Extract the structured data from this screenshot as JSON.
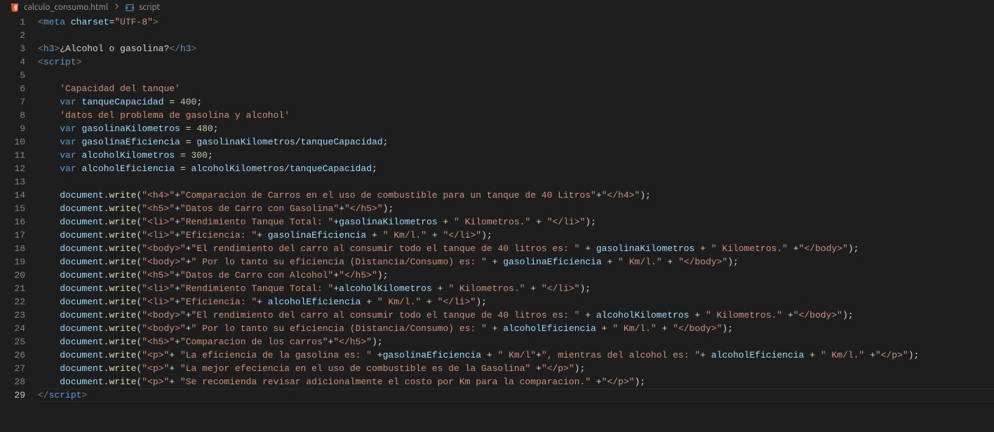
{
  "breadcrumb": {
    "file": "calculo_consumo.html",
    "symbol": "script"
  },
  "active_line": 29,
  "lines": [
    {
      "n": 1,
      "tokens": [
        [
          "punc",
          "<"
        ],
        [
          "tag",
          "meta"
        ],
        [
          "text",
          " "
        ],
        [
          "attr",
          "charset"
        ],
        [
          "op",
          "="
        ],
        [
          "str",
          "\"UTF-8\""
        ],
        [
          "punc",
          ">"
        ]
      ]
    },
    {
      "n": 2,
      "tokens": []
    },
    {
      "n": 3,
      "tokens": [
        [
          "punc",
          "<"
        ],
        [
          "tag",
          "h3"
        ],
        [
          "punc",
          ">"
        ],
        [
          "text",
          "¿Alcohol o gasolina?"
        ],
        [
          "punc",
          "</"
        ],
        [
          "tag",
          "h3"
        ],
        [
          "punc",
          ">"
        ]
      ]
    },
    {
      "n": 4,
      "tokens": [
        [
          "punc",
          "<"
        ],
        [
          "tag",
          "script"
        ],
        [
          "punc",
          ">"
        ]
      ]
    },
    {
      "n": 5,
      "tokens": []
    },
    {
      "n": 6,
      "indent": 4,
      "tokens": [
        [
          "str",
          "'Capacidad del tanque'"
        ]
      ]
    },
    {
      "n": 7,
      "indent": 4,
      "tokens": [
        [
          "kw",
          "var"
        ],
        [
          "text",
          " "
        ],
        [
          "var",
          "tanqueCapacidad"
        ],
        [
          "text",
          " "
        ],
        [
          "op",
          "="
        ],
        [
          "text",
          " "
        ],
        [
          "num",
          "400"
        ],
        [
          "text",
          ";"
        ]
      ]
    },
    {
      "n": 8,
      "indent": 4,
      "tokens": [
        [
          "str",
          "'datos del problema de gasolina y alcohol'"
        ]
      ]
    },
    {
      "n": 9,
      "indent": 4,
      "tokens": [
        [
          "kw",
          "var"
        ],
        [
          "text",
          " "
        ],
        [
          "var",
          "gasolinaKilometros"
        ],
        [
          "text",
          " "
        ],
        [
          "op",
          "="
        ],
        [
          "text",
          " "
        ],
        [
          "num",
          "480"
        ],
        [
          "text",
          ";"
        ]
      ]
    },
    {
      "n": 10,
      "indent": 4,
      "tokens": [
        [
          "kw",
          "var"
        ],
        [
          "text",
          " "
        ],
        [
          "var",
          "gasolinaEficiencia"
        ],
        [
          "text",
          " "
        ],
        [
          "op",
          "="
        ],
        [
          "text",
          " "
        ],
        [
          "var",
          "gasolinaKilometros"
        ],
        [
          "op",
          "/"
        ],
        [
          "var",
          "tanqueCapacidad"
        ],
        [
          "text",
          ";"
        ]
      ]
    },
    {
      "n": 11,
      "indent": 4,
      "tokens": [
        [
          "kw",
          "var"
        ],
        [
          "text",
          " "
        ],
        [
          "var",
          "alcoholKilometros"
        ],
        [
          "text",
          " "
        ],
        [
          "op",
          "="
        ],
        [
          "text",
          " "
        ],
        [
          "num",
          "300"
        ],
        [
          "text",
          ";"
        ]
      ]
    },
    {
      "n": 12,
      "indent": 4,
      "tokens": [
        [
          "kw",
          "var"
        ],
        [
          "text",
          " "
        ],
        [
          "var",
          "alcoholEficiencia"
        ],
        [
          "text",
          " "
        ],
        [
          "op",
          "="
        ],
        [
          "text",
          " "
        ],
        [
          "var",
          "alcoholKilometros"
        ],
        [
          "op",
          "/"
        ],
        [
          "var",
          "tanqueCapacidad"
        ],
        [
          "text",
          ";"
        ]
      ]
    },
    {
      "n": 13,
      "tokens": []
    },
    {
      "n": 14,
      "indent": 4,
      "tokens": [
        [
          "obj",
          "document"
        ],
        [
          "text",
          "."
        ],
        [
          "fn",
          "write"
        ],
        [
          "text",
          "("
        ],
        [
          "str",
          "\"<h4>\""
        ],
        [
          "op",
          "+"
        ],
        [
          "str",
          "\"Comparacion de Carros en el uso de combustible para un tanque de 40 Litros\""
        ],
        [
          "op",
          "+"
        ],
        [
          "str",
          "\"</h4>\""
        ],
        [
          "text",
          ");"
        ]
      ]
    },
    {
      "n": 15,
      "indent": 4,
      "tokens": [
        [
          "obj",
          "document"
        ],
        [
          "text",
          "."
        ],
        [
          "fn",
          "write"
        ],
        [
          "text",
          "("
        ],
        [
          "str",
          "\"<h5>\""
        ],
        [
          "op",
          "+"
        ],
        [
          "str",
          "\"Datos de Carro con Gasolina\""
        ],
        [
          "op",
          "+"
        ],
        [
          "str",
          "\"</h5>\""
        ],
        [
          "text",
          ");"
        ]
      ]
    },
    {
      "n": 16,
      "indent": 4,
      "tokens": [
        [
          "obj",
          "document"
        ],
        [
          "text",
          "."
        ],
        [
          "fn",
          "write"
        ],
        [
          "text",
          "("
        ],
        [
          "str",
          "\"<li>\""
        ],
        [
          "op",
          "+"
        ],
        [
          "str",
          "\"Rendimiento Tanque Total: \""
        ],
        [
          "op",
          "+"
        ],
        [
          "var",
          "gasolinaKilometros"
        ],
        [
          "text",
          " "
        ],
        [
          "op",
          "+"
        ],
        [
          "text",
          " "
        ],
        [
          "str",
          "\" Kilometros.\""
        ],
        [
          "text",
          " "
        ],
        [
          "op",
          "+"
        ],
        [
          "text",
          " "
        ],
        [
          "str",
          "\"</li>\""
        ],
        [
          "text",
          ");"
        ]
      ]
    },
    {
      "n": 17,
      "indent": 4,
      "tokens": [
        [
          "obj",
          "document"
        ],
        [
          "text",
          "."
        ],
        [
          "fn",
          "write"
        ],
        [
          "text",
          "("
        ],
        [
          "str",
          "\"<li>\""
        ],
        [
          "op",
          "+"
        ],
        [
          "str",
          "\"Eficiencia: \""
        ],
        [
          "op",
          "+"
        ],
        [
          "text",
          " "
        ],
        [
          "var",
          "gasolinaEficiencia"
        ],
        [
          "text",
          " "
        ],
        [
          "op",
          "+"
        ],
        [
          "text",
          " "
        ],
        [
          "str",
          "\" Km/l.\""
        ],
        [
          "text",
          " "
        ],
        [
          "op",
          "+"
        ],
        [
          "text",
          " "
        ],
        [
          "str",
          "\"</li>\""
        ],
        [
          "text",
          ");"
        ]
      ]
    },
    {
      "n": 18,
      "indent": 4,
      "tokens": [
        [
          "obj",
          "document"
        ],
        [
          "text",
          "."
        ],
        [
          "fn",
          "write"
        ],
        [
          "text",
          "("
        ],
        [
          "str",
          "\"<body>\""
        ],
        [
          "op",
          "+"
        ],
        [
          "str",
          "\"El rendimiento del carro al consumir todo el tanque de 40 litros es: \""
        ],
        [
          "text",
          " "
        ],
        [
          "op",
          "+"
        ],
        [
          "text",
          " "
        ],
        [
          "var",
          "gasolinaKilometros"
        ],
        [
          "text",
          " "
        ],
        [
          "op",
          "+"
        ],
        [
          "text",
          " "
        ],
        [
          "str",
          "\" Kilometros.\""
        ],
        [
          "text",
          " "
        ],
        [
          "op",
          "+"
        ],
        [
          "str",
          "\"</body>\""
        ],
        [
          "text",
          ");"
        ]
      ]
    },
    {
      "n": 19,
      "indent": 4,
      "tokens": [
        [
          "obj",
          "document"
        ],
        [
          "text",
          "."
        ],
        [
          "fn",
          "write"
        ],
        [
          "text",
          "("
        ],
        [
          "str",
          "\"<body>\""
        ],
        [
          "op",
          "+"
        ],
        [
          "str",
          "\" Por lo tanto su eficiencia (Distancia/Consumo) es: \""
        ],
        [
          "text",
          " "
        ],
        [
          "op",
          "+"
        ],
        [
          "text",
          " "
        ],
        [
          "var",
          "gasolinaEficiencia"
        ],
        [
          "text",
          " "
        ],
        [
          "op",
          "+"
        ],
        [
          "text",
          " "
        ],
        [
          "str",
          "\" Km/l.\""
        ],
        [
          "text",
          " "
        ],
        [
          "op",
          "+"
        ],
        [
          "text",
          " "
        ],
        [
          "str",
          "\"</body>\""
        ],
        [
          "text",
          ");"
        ]
      ]
    },
    {
      "n": 20,
      "indent": 4,
      "tokens": [
        [
          "obj",
          "document"
        ],
        [
          "text",
          "."
        ],
        [
          "fn",
          "write"
        ],
        [
          "text",
          "("
        ],
        [
          "str",
          "\"<h5>\""
        ],
        [
          "op",
          "+"
        ],
        [
          "str",
          "\"Datos de Carro con Alcohol\""
        ],
        [
          "op",
          "+"
        ],
        [
          "str",
          "\"</h5>\""
        ],
        [
          "text",
          ");"
        ]
      ]
    },
    {
      "n": 21,
      "indent": 4,
      "tokens": [
        [
          "obj",
          "document"
        ],
        [
          "text",
          "."
        ],
        [
          "fn",
          "write"
        ],
        [
          "text",
          "("
        ],
        [
          "str",
          "\"<li>\""
        ],
        [
          "op",
          "+"
        ],
        [
          "str",
          "\"Rendimiento Tanque Total: \""
        ],
        [
          "op",
          "+"
        ],
        [
          "var",
          "alcoholKilometros"
        ],
        [
          "text",
          " "
        ],
        [
          "op",
          "+"
        ],
        [
          "text",
          " "
        ],
        [
          "str",
          "\" Kilometros.\""
        ],
        [
          "text",
          " "
        ],
        [
          "op",
          "+"
        ],
        [
          "text",
          " "
        ],
        [
          "str",
          "\"</li>\""
        ],
        [
          "text",
          ");"
        ]
      ]
    },
    {
      "n": 22,
      "indent": 4,
      "tokens": [
        [
          "obj",
          "document"
        ],
        [
          "text",
          "."
        ],
        [
          "fn",
          "write"
        ],
        [
          "text",
          "("
        ],
        [
          "str",
          "\"<li>\""
        ],
        [
          "op",
          "+"
        ],
        [
          "str",
          "\"Eficiencia: \""
        ],
        [
          "op",
          "+"
        ],
        [
          "text",
          " "
        ],
        [
          "var",
          "alcoholEficiencia"
        ],
        [
          "text",
          " "
        ],
        [
          "op",
          "+"
        ],
        [
          "text",
          " "
        ],
        [
          "str",
          "\" Km/l.\""
        ],
        [
          "text",
          " "
        ],
        [
          "op",
          "+"
        ],
        [
          "text",
          " "
        ],
        [
          "str",
          "\"</li>\""
        ],
        [
          "text",
          ");"
        ]
      ]
    },
    {
      "n": 23,
      "indent": 4,
      "tokens": [
        [
          "obj",
          "document"
        ],
        [
          "text",
          "."
        ],
        [
          "fn",
          "write"
        ],
        [
          "text",
          "("
        ],
        [
          "str",
          "\"<body>\""
        ],
        [
          "op",
          "+"
        ],
        [
          "str",
          "\"El rendimiento del carro al consumir todo el tanque de 40 litros es: \""
        ],
        [
          "text",
          " "
        ],
        [
          "op",
          "+"
        ],
        [
          "text",
          " "
        ],
        [
          "var",
          "alcoholKilometros"
        ],
        [
          "text",
          " "
        ],
        [
          "op",
          "+"
        ],
        [
          "text",
          " "
        ],
        [
          "str",
          "\" Kilometros.\""
        ],
        [
          "text",
          " "
        ],
        [
          "op",
          "+"
        ],
        [
          "str",
          "\"</body>\""
        ],
        [
          "text",
          ");"
        ]
      ]
    },
    {
      "n": 24,
      "indent": 4,
      "tokens": [
        [
          "obj",
          "document"
        ],
        [
          "text",
          "."
        ],
        [
          "fn",
          "write"
        ],
        [
          "text",
          "("
        ],
        [
          "str",
          "\"<body>\""
        ],
        [
          "op",
          "+"
        ],
        [
          "str",
          "\" Por lo tanto su eficiencia (Distancia/Consumo) es: \""
        ],
        [
          "text",
          " "
        ],
        [
          "op",
          "+"
        ],
        [
          "text",
          " "
        ],
        [
          "var",
          "alcoholEficiencia"
        ],
        [
          "text",
          " "
        ],
        [
          "op",
          "+"
        ],
        [
          "text",
          " "
        ],
        [
          "str",
          "\" Km/l.\""
        ],
        [
          "text",
          " "
        ],
        [
          "op",
          "+"
        ],
        [
          "text",
          " "
        ],
        [
          "str",
          "\"</body>\""
        ],
        [
          "text",
          ");"
        ]
      ]
    },
    {
      "n": 25,
      "indent": 4,
      "tokens": [
        [
          "obj",
          "document"
        ],
        [
          "text",
          "."
        ],
        [
          "fn",
          "write"
        ],
        [
          "text",
          "("
        ],
        [
          "str",
          "\"<h5>\""
        ],
        [
          "op",
          "+"
        ],
        [
          "str",
          "\"Comparacion de los carros\""
        ],
        [
          "op",
          "+"
        ],
        [
          "str",
          "\"</h5>\""
        ],
        [
          "text",
          ");"
        ]
      ]
    },
    {
      "n": 26,
      "indent": 4,
      "tokens": [
        [
          "obj",
          "document"
        ],
        [
          "text",
          "."
        ],
        [
          "fn",
          "write"
        ],
        [
          "text",
          "("
        ],
        [
          "str",
          "\"<p>\""
        ],
        [
          "op",
          "+"
        ],
        [
          "text",
          " "
        ],
        [
          "str",
          "\"La eficiencia de la gasolina es: \""
        ],
        [
          "text",
          " "
        ],
        [
          "op",
          "+"
        ],
        [
          "var",
          "gasolinaEficiencia"
        ],
        [
          "text",
          " "
        ],
        [
          "op",
          "+"
        ],
        [
          "text",
          " "
        ],
        [
          "str",
          "\" Km/l\""
        ],
        [
          "op",
          "+"
        ],
        [
          "str",
          "\", mientras del alcohol es: \""
        ],
        [
          "op",
          "+"
        ],
        [
          "text",
          " "
        ],
        [
          "var",
          "alcoholEficiencia"
        ],
        [
          "text",
          " "
        ],
        [
          "op",
          "+"
        ],
        [
          "text",
          " "
        ],
        [
          "str",
          "\" Km/l.\""
        ],
        [
          "text",
          " "
        ],
        [
          "op",
          "+"
        ],
        [
          "str",
          "\"</p>\""
        ],
        [
          "text",
          ");"
        ]
      ]
    },
    {
      "n": 27,
      "indent": 4,
      "tokens": [
        [
          "obj",
          "document"
        ],
        [
          "text",
          "."
        ],
        [
          "fn",
          "write"
        ],
        [
          "text",
          "("
        ],
        [
          "str",
          "\"<p>\""
        ],
        [
          "op",
          "+"
        ],
        [
          "text",
          " "
        ],
        [
          "str",
          "\"La mejor efeciencia en el uso de combustible es de la Gasolina\""
        ],
        [
          "text",
          " "
        ],
        [
          "op",
          "+"
        ],
        [
          "str",
          "\"</p>\""
        ],
        [
          "text",
          ");"
        ]
      ]
    },
    {
      "n": 28,
      "indent": 4,
      "tokens": [
        [
          "obj",
          "document"
        ],
        [
          "text",
          "."
        ],
        [
          "fn",
          "write"
        ],
        [
          "text",
          "("
        ],
        [
          "str",
          "\"<p>\""
        ],
        [
          "op",
          "+"
        ],
        [
          "text",
          " "
        ],
        [
          "str",
          "\"Se recomienda revisar adicionalmente el costo por Km para la comparacion.\""
        ],
        [
          "text",
          " "
        ],
        [
          "op",
          "+"
        ],
        [
          "str",
          "\"</p>\""
        ],
        [
          "text",
          ");"
        ]
      ]
    },
    {
      "n": 29,
      "tokens": [
        [
          "punc",
          "</"
        ],
        [
          "tag",
          "script"
        ],
        [
          "punc",
          ">"
        ]
      ]
    }
  ]
}
